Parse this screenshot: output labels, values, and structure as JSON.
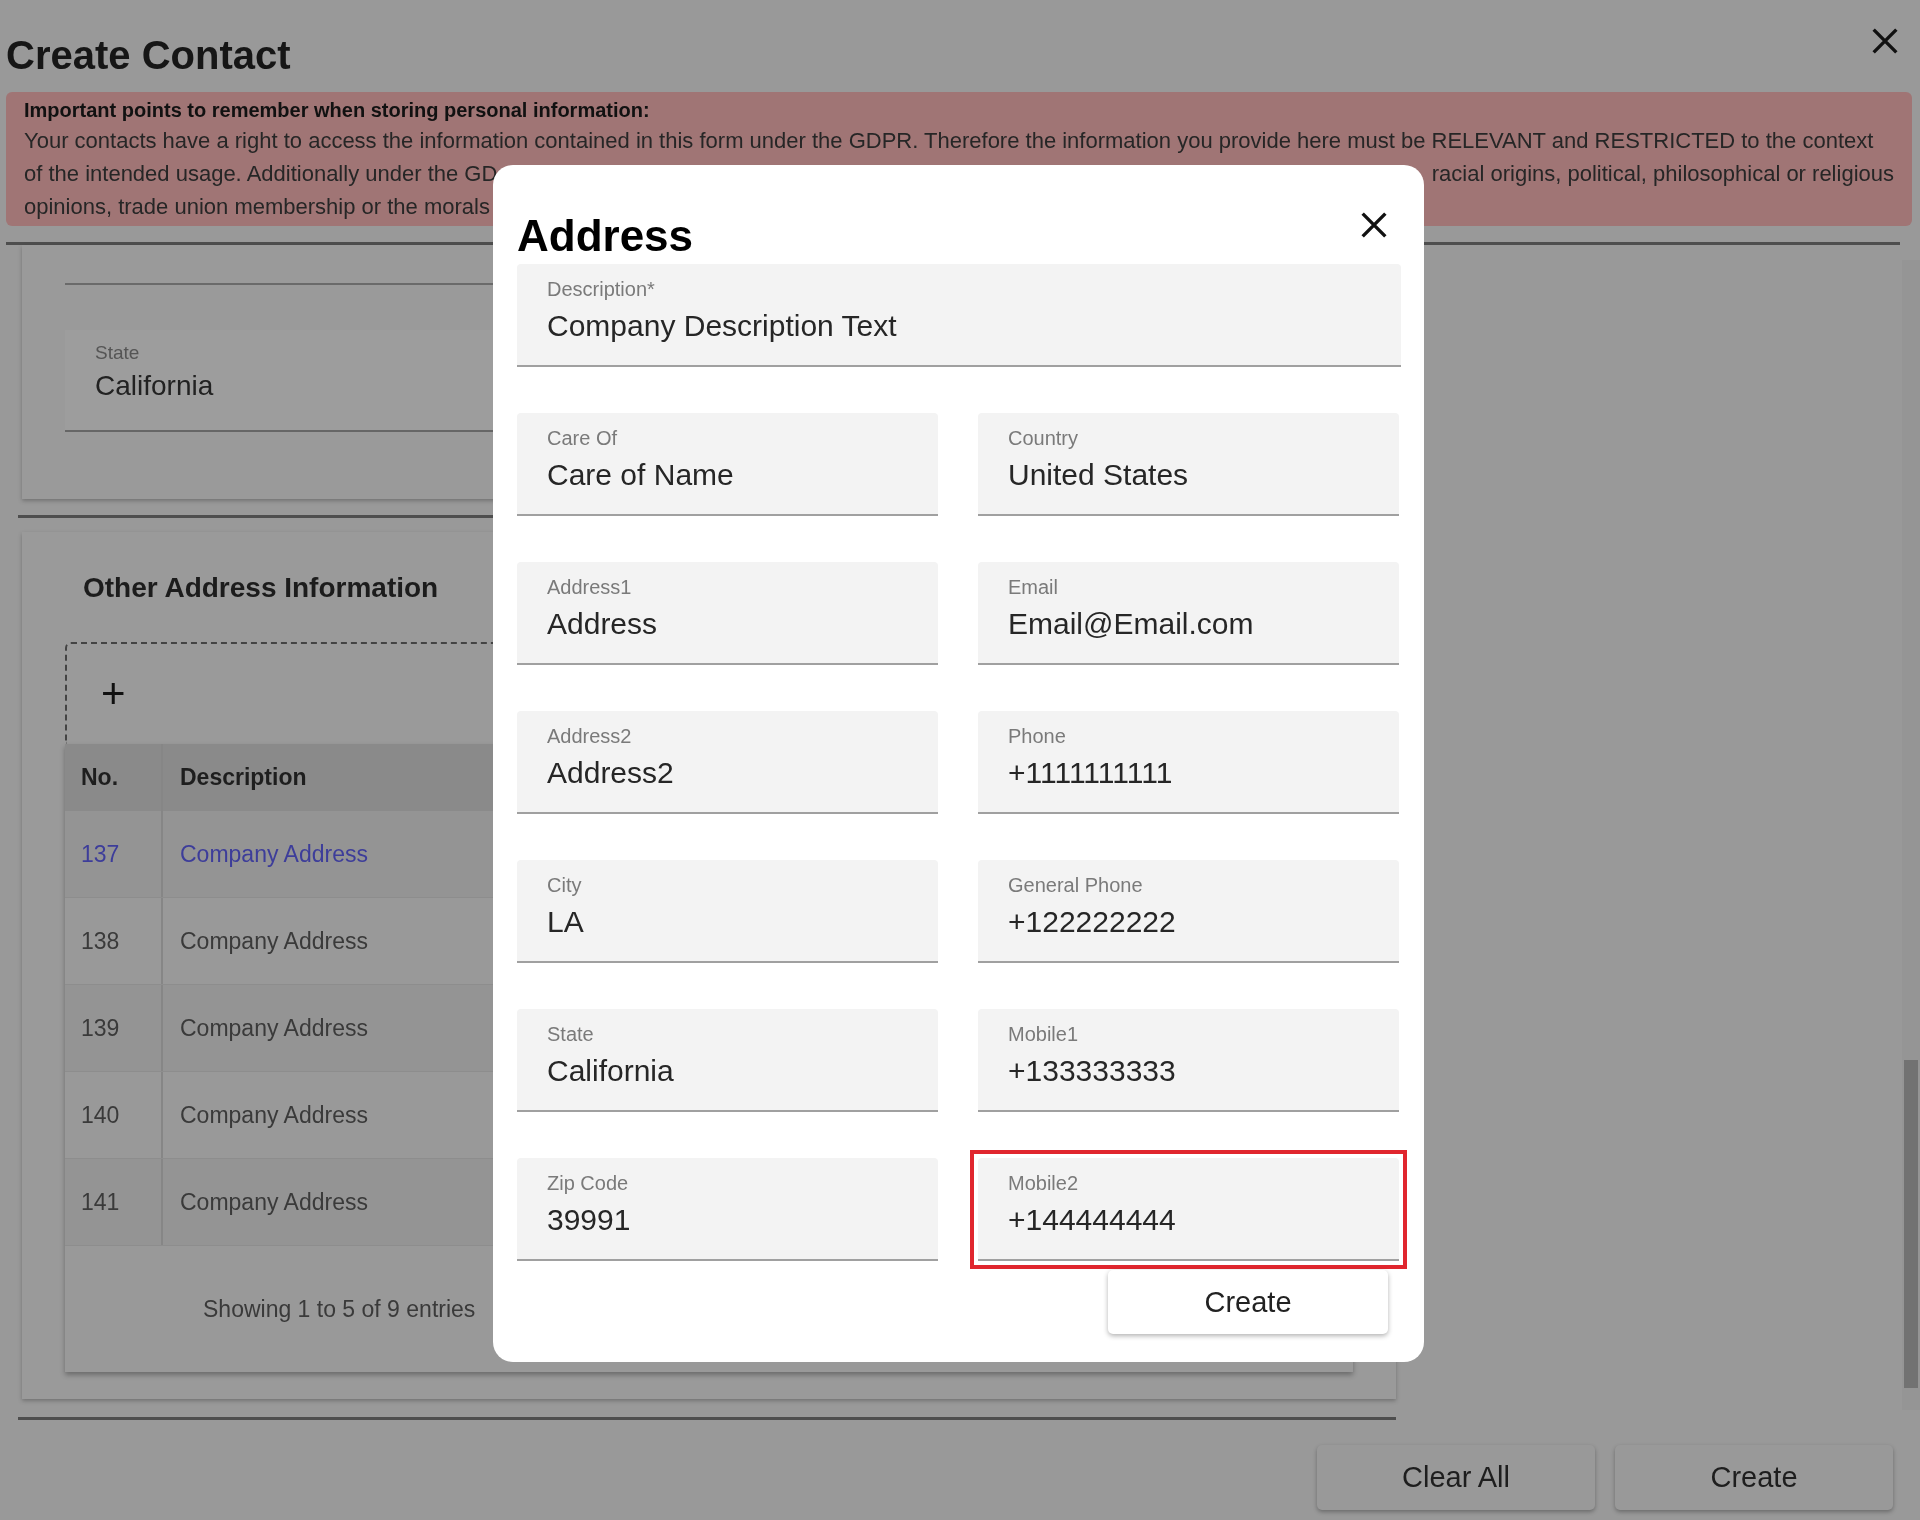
{
  "window": {
    "title": "Create Contact"
  },
  "notice": {
    "heading": "Important points to remember when storing personal information:",
    "lines": [
      [
        "Your contacts have a right to access the information contained in this form under the GDPR. Therefore the information you provide here must be RELEVANT and RESTRICTED to the context"
      ],
      [
        "of the intended usage. Additionally under the GD",
        "racial origins, political, philosophical or religious"
      ],
      [
        "opinions, trade union membership or the morals"
      ]
    ]
  },
  "state_field": {
    "label": "State",
    "value": "California"
  },
  "other_address": {
    "title": "Other Address Information",
    "add_button": "+",
    "columns": [
      "No.",
      "Description"
    ],
    "rows": [
      {
        "no": "137",
        "description": "Company Address",
        "selected": true
      },
      {
        "no": "138",
        "description": "Company Address",
        "selected": false
      },
      {
        "no": "139",
        "description": "Company Address",
        "selected": false
      },
      {
        "no": "140",
        "description": "Company Address",
        "selected": false
      },
      {
        "no": "141",
        "description": "Company Address",
        "selected": false
      }
    ],
    "footer": "Showing 1 to 5 of 9 entries"
  },
  "buttons": [
    "Clear All",
    "Create"
  ],
  "dialog": {
    "title": "Address",
    "description": {
      "label": "Description*",
      "value": "Company Description Text"
    },
    "fields": [
      {
        "label": "Care Of",
        "value": "Care of Name",
        "highlighted": false
      },
      {
        "label": "Country",
        "value": "United States",
        "highlighted": false
      },
      {
        "label": "Address1",
        "value": "Address",
        "highlighted": false
      },
      {
        "label": "Email",
        "value": "Email@Email.com",
        "highlighted": false
      },
      {
        "label": "Address2",
        "value": "Address2",
        "highlighted": false
      },
      {
        "label": "Phone",
        "value": "+1111111111",
        "highlighted": false
      },
      {
        "label": "City",
        "value": "LA",
        "highlighted": false
      },
      {
        "label": "General Phone",
        "value": "+122222222",
        "highlighted": false
      },
      {
        "label": "State",
        "value": "California",
        "highlighted": false
      },
      {
        "label": "Mobile1",
        "value": "+133333333",
        "highlighted": false
      },
      {
        "label": "Zip Code",
        "value": "39991",
        "highlighted": false
      },
      {
        "label": "Mobile2",
        "value": "+144444444",
        "highlighted": true
      }
    ],
    "submit": "Create"
  }
}
